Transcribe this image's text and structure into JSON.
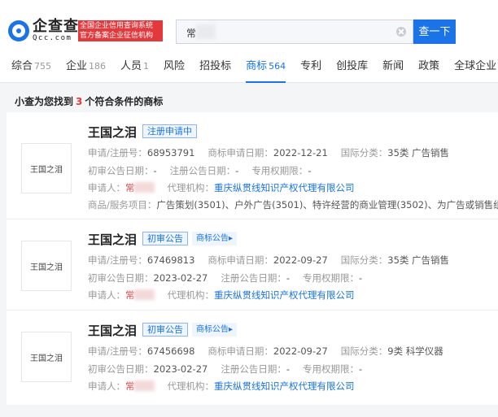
{
  "header": {
    "logo_cn": "企查查",
    "logo_en": "Qcc.com",
    "slogan_line1": "全国企业信用查询系统",
    "slogan_line2": "官方备案企业征信机构",
    "search_value": "常",
    "search_button": "查一下"
  },
  "tabs": [
    {
      "label": "综合",
      "count": "755"
    },
    {
      "label": "企业",
      "count": "186"
    },
    {
      "label": "人员",
      "count": "1"
    },
    {
      "label": "风险",
      "count": ""
    },
    {
      "label": "招投标",
      "count": ""
    },
    {
      "label": "商标",
      "count": "564"
    },
    {
      "label": "专利",
      "count": ""
    },
    {
      "label": "创投库",
      "count": ""
    },
    {
      "label": "新闻",
      "count": ""
    },
    {
      "label": "政策",
      "count": ""
    },
    {
      "label": "全球企业",
      "count": ""
    }
  ],
  "summary": {
    "prefix": "小查为您找到",
    "count": "3",
    "suffix": "个符合条件的商标"
  },
  "labels": {
    "reg_no": "申请/注册号：",
    "apply_date": "商标申请日期：",
    "intl_class": "国际分类：",
    "prelim_date": "初审公告日期：",
    "reg_pub_date": "注册公告日期：",
    "exclusive_period": "专用权期限：",
    "applicant": "申请人：",
    "agency": "代理机构：",
    "goods": "商品/服务项目："
  },
  "results": [
    {
      "thumb_text": "王国之泪",
      "name": "王国之泪",
      "status": "注册申请中",
      "notice_link": "",
      "reg_no": "68953791",
      "apply_date": "2022-12-21",
      "intl_class": "35类 广告销售",
      "prelim_date": "-",
      "reg_pub_date": "-",
      "exclusive_period": "-",
      "applicant": "常",
      "agency": "重庆纵贯线知识产权代理有限公司",
      "goods": "广告策划(3501)、户外广告(3501)、特许经营的商业管理(3502)、为广告或销售组织时"
    },
    {
      "thumb_text": "王国之泪",
      "name": "王国之泪",
      "status": "初审公告",
      "notice_link": "商标公告▸",
      "reg_no": "67469813",
      "apply_date": "2022-09-27",
      "intl_class": "35类 广告销售",
      "prelim_date": "2023-02-27",
      "reg_pub_date": "-",
      "exclusive_period": "-",
      "applicant": "常",
      "agency": "重庆纵贯线知识产权代理有限公司",
      "goods": ""
    },
    {
      "thumb_text": "王国之泪",
      "name": "王国之泪",
      "status": "初审公告",
      "notice_link": "商标公告▸",
      "reg_no": "67456698",
      "apply_date": "2022-09-27",
      "intl_class": "9类 科学仪器",
      "prelim_date": "2023-02-27",
      "reg_pub_date": "-",
      "exclusive_period": "-",
      "applicant": "常",
      "agency": "重庆纵贯线知识产权代理有限公司",
      "goods": ""
    }
  ],
  "colors": {
    "accent": "#1a74e8",
    "highlight": "#e4393c"
  }
}
